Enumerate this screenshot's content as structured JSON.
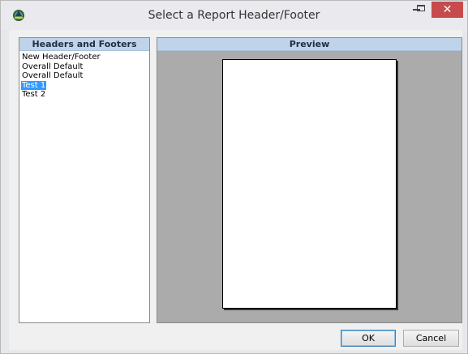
{
  "window": {
    "title": "Select a Report Header/Footer",
    "controls": {
      "minimize": "–",
      "maximize": "☐",
      "close": "✕"
    }
  },
  "left_panel": {
    "header": "Headers and Footers",
    "items": [
      {
        "label": "New Header/Footer",
        "selected": false
      },
      {
        "label": "Overall Default",
        "selected": false
      },
      {
        "label": "Overall Default",
        "selected": false
      },
      {
        "label": "Test 1",
        "selected": true
      },
      {
        "label": "Test 2",
        "selected": false
      }
    ]
  },
  "right_panel": {
    "header": "Preview"
  },
  "buttons": {
    "ok": "OK",
    "cancel": "Cancel"
  },
  "colors": {
    "selection": "#3399ff",
    "panel_header": "#bfd4ea",
    "close_button": "#c74b4c",
    "preview_bg": "#ababab"
  },
  "icons": {
    "app": "app-logo-icon",
    "minimize": "minimize-icon",
    "maximize": "maximize-icon",
    "close": "close-icon"
  }
}
